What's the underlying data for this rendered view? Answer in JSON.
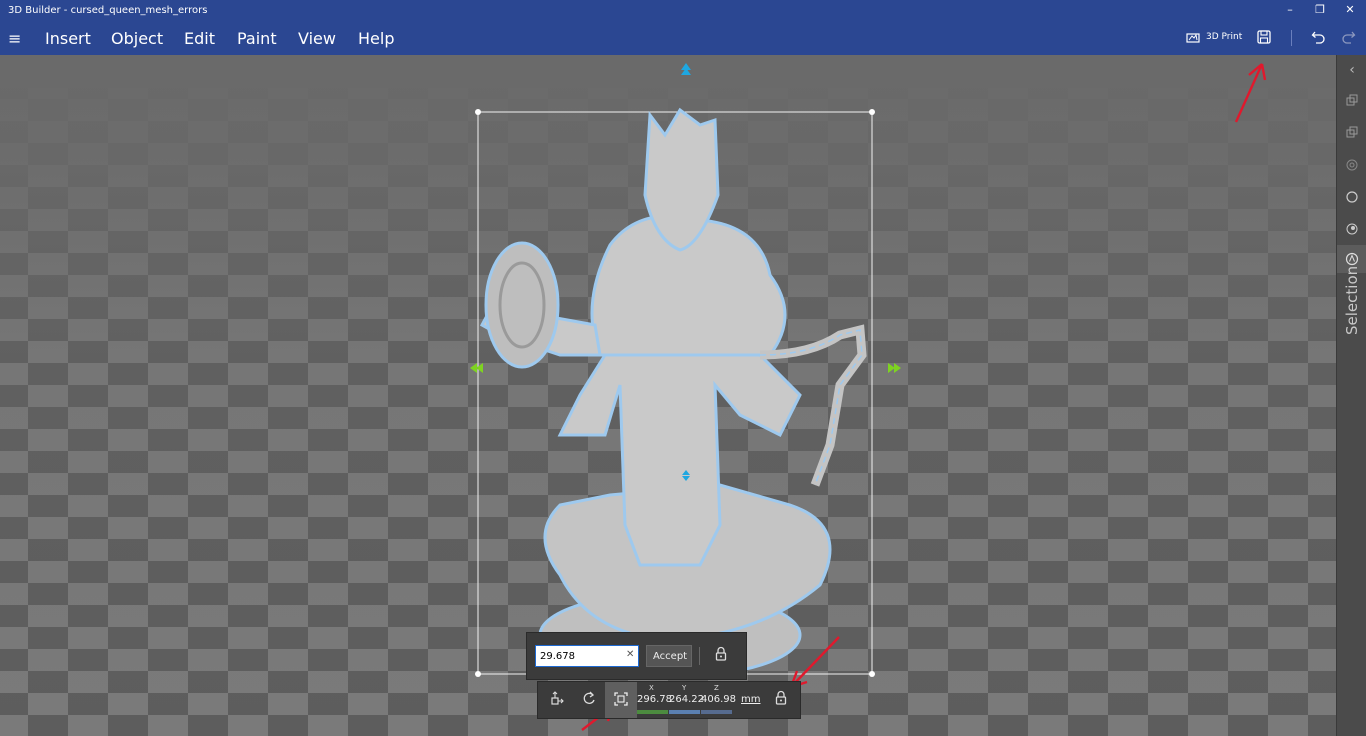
{
  "window": {
    "title": "3D Builder - cursed_queen_mesh_errors",
    "minimize": "–",
    "restore": "❐",
    "close": "✕"
  },
  "menu": {
    "hamburger": "≡",
    "items": [
      {
        "label": "Insert"
      },
      {
        "label": "Object"
      },
      {
        "label": "Edit"
      },
      {
        "label": "Paint"
      },
      {
        "label": "View"
      },
      {
        "label": "Help"
      }
    ]
  },
  "toolbar": {
    "print_label": "3D Print"
  },
  "sidebar": {
    "collapse": "‹",
    "label": "Selection"
  },
  "scale_panel": {
    "value": "29.678",
    "clear": "✕",
    "accept_label": "Accept"
  },
  "dimensions": {
    "x_label": "X",
    "x_value": "296.78",
    "y_label": "Y",
    "y_value": "264.22",
    "z_label": "Z",
    "z_value": "406.98",
    "unit": "mm"
  },
  "colors": {
    "titlebar": "#2b4792",
    "selection_highlight": "#9ec9ee",
    "handle_blue": "#1ea7e1",
    "handle_green": "#7ed321",
    "annotation_arrow": "#e0192d",
    "x_axis": "#4c8b3f",
    "y_axis": "#5a7fb0",
    "z_axis": "#566b8f"
  }
}
